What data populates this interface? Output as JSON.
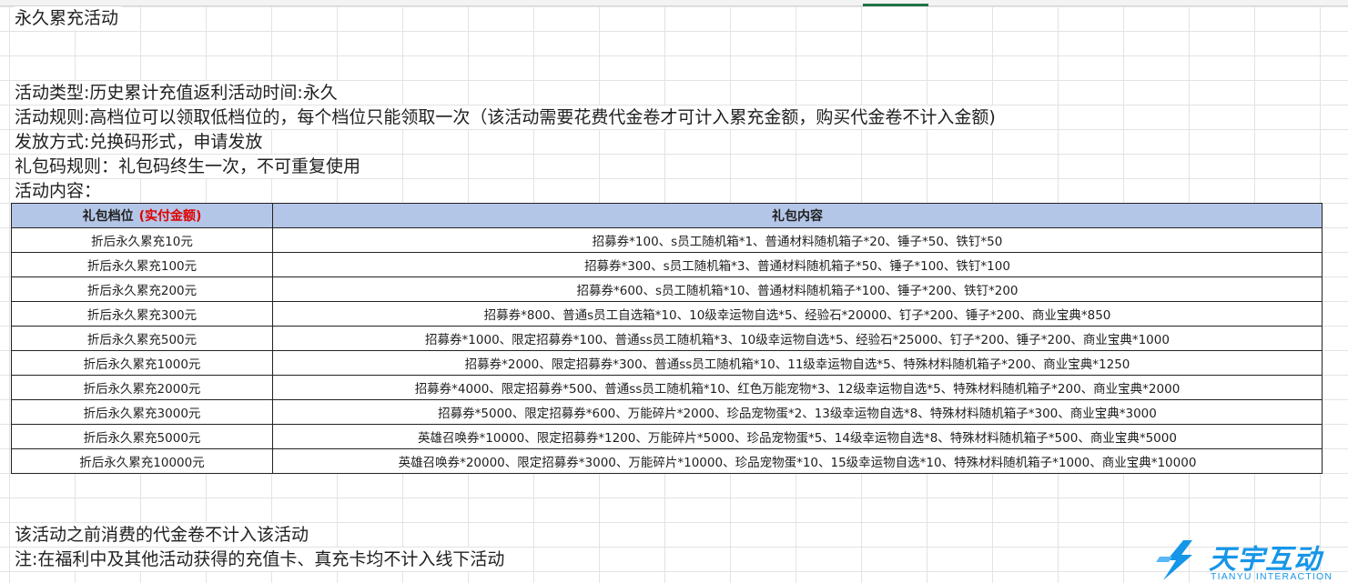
{
  "sheet": {
    "title": "永久累充活动",
    "lines": [
      "活动类型:历史累计充值返利活动时间:永久",
      "活动规则:高档位可以领取低档位的，每个档位只能领取一次（该活动需要花费代金卷才可计入累充金额，购买代金卷不计入金额)",
      "发放方式:兑换码形式，申请发放",
      "礼包码规则：礼包码终生一次，不可重复使用",
      "活动内容："
    ],
    "table": {
      "header_tier": "礼包档位",
      "header_tier_note": "(实付金额)",
      "header_content": "礼包内容",
      "rows": [
        {
          "tier": "折后永久累充10元",
          "content": "招募券*100、s员工随机箱*1、普通材料随机箱子*20、锤子*50、铁钉*50"
        },
        {
          "tier": "折后永久累充100元",
          "content": "招募券*300、s员工随机箱*3、普通材料随机箱子*50、锤子*100、铁钉*100"
        },
        {
          "tier": "折后永久累充200元",
          "content": "招募券*600、s员工随机箱*10、普通材料随机箱子*100、锤子*200、铁钉*200"
        },
        {
          "tier": "折后永久累充300元",
          "content": "招募券*800、普通s员工自选箱*10、10级幸运物自选*5、经验石*20000、钉子*200、锤子*200、商业宝典*850"
        },
        {
          "tier": "折后永久累充500元",
          "content": "招募券*1000、限定招募券*100、普通ss员工随机箱*3、10级幸运物自选*5、经验石*25000、钉子*200、锤子*200、商业宝典*1000"
        },
        {
          "tier": "折后永久累充1000元",
          "content": "招募券*2000、限定招募券*300、普通ss员工随机箱*10、11级幸运物自选*5、特殊材料随机箱子*200、商业宝典*1250"
        },
        {
          "tier": "折后永久累充2000元",
          "content": "招募券*4000、限定招募券*500、普通ss员工随机箱*10、红色万能宠物*3、12级幸运物自选*5、特殊材料随机箱子*200、商业宝典*2000"
        },
        {
          "tier": "折后永久累充3000元",
          "content": "招募券*5000、限定招募券*600、万能碎片*2000、珍品宠物蛋*2、13级幸运物自选*8、特殊材料随机箱子*300、商业宝典*3000"
        },
        {
          "tier": "折后永久累充5000元",
          "content": "英雄召唤券*10000、限定招募券*1200、万能碎片*5000、珍品宠物蛋*5、14级幸运物自选*8、特殊材料随机箱子*500、商业宝典*5000"
        },
        {
          "tier": "折后永久累充10000元",
          "content": "英雄召唤券*20000、限定招募券*3000、万能碎片*10000、珍品宠物蛋*10、15级幸运物自选*10、特殊材料随机箱子*1000、商业宝典*10000"
        }
      ]
    },
    "notes": [
      "该活动之前消费的代金卷不计入该活动",
      "注:在福利中及其他活动获得的充值卡、真充卡均不计入线下活动"
    ]
  },
  "logo": {
    "name": "天宇互动",
    "sub": "TIANYU INTERACTION",
    "icon": "tianyu-logo-icon",
    "color": "#1696e8"
  },
  "colors": {
    "header_bg": "#b4c6e7",
    "note_red": "#e00000",
    "grid": "#e3e3e3"
  }
}
